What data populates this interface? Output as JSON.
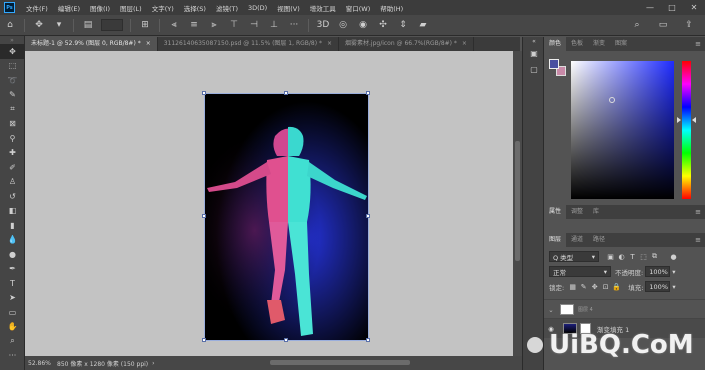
{
  "app": {
    "logo": "Ps"
  },
  "menu": [
    "文件(F)",
    "编辑(E)",
    "图像(I)",
    "图层(L)",
    "文字(Y)",
    "选择(S)",
    "滤镜(T)",
    "3D(D)",
    "视图(V)",
    "增效工具",
    "窗口(W)",
    "帮助(H)"
  ],
  "window_controls": {
    "minimize": "—",
    "maximize": "□",
    "close": "✕"
  },
  "tabs": [
    {
      "label": "未标题-1 @ 52.9% (图层 0, RGB/8#) *",
      "close": "×"
    },
    {
      "label": "31126140635087150.psd @ 11.5% (图层 1, RGB/8) *",
      "close": "×"
    },
    {
      "label": "烟雾素材.jpg/icon @ 66.7%(RGB/8#) *",
      "close": "×"
    }
  ],
  "status": {
    "zoom": "52.86%",
    "info": "850 像素 x 1280 像素 (150 ppi)",
    "arrow": "›"
  },
  "color_panel": {
    "tabs": [
      "颜色",
      "色板",
      "渐变",
      "图案"
    ],
    "menu": "≡",
    "foreground": "#4a4fa0",
    "background": "#c98aa8"
  },
  "properties_panel": {
    "tabs": [
      "属性",
      "调整",
      "库"
    ],
    "menu": "≡"
  },
  "layers_panel": {
    "tabs": [
      "图层",
      "通道",
      "路径"
    ],
    "menu": "≡",
    "kind_filter": "Q 类型",
    "blend_mode": "正常",
    "opacity_label": "不透明度:",
    "opacity_value": "100%",
    "lock_label": "锁定:",
    "fill_label": "填充:",
    "fill_value": "100%",
    "layers": [
      {
        "name": "图层 4",
        "visible": false
      },
      {
        "name": "渐变填充 1",
        "visible": true
      }
    ]
  },
  "watermark": {
    "text": "UiBQ.CoM"
  }
}
